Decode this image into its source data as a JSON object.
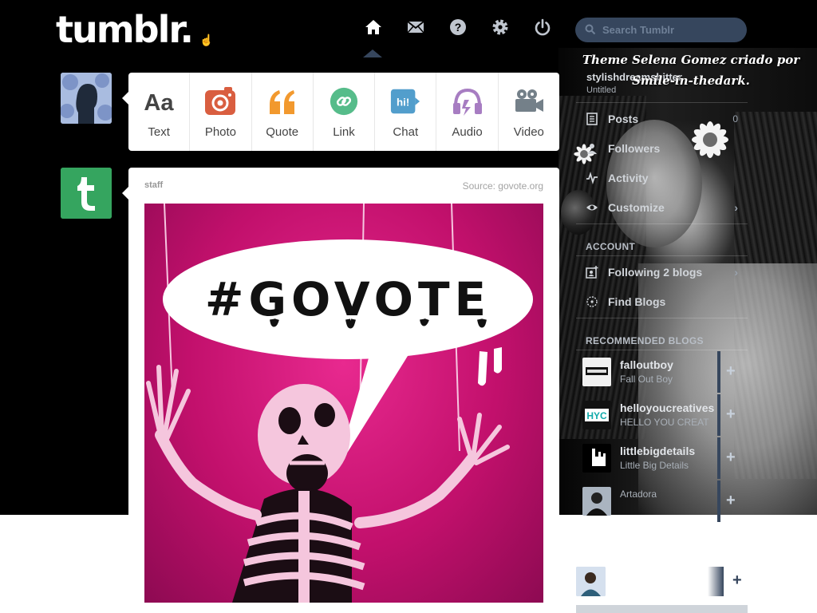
{
  "header": {
    "logo": "tumblr.",
    "search_placeholder": "Search Tumblr",
    "nav": [
      "home-icon",
      "inbox-icon",
      "help-icon",
      "settings-icon",
      "logout-icon"
    ],
    "accent_color": "#36465d"
  },
  "theme_credit": {
    "line1": "Theme Selena Gomez criado por",
    "line2": "Smile-in-thedark."
  },
  "post_types": [
    {
      "label": "Text",
      "icon": "text-icon",
      "color": "#444444"
    },
    {
      "label": "Photo",
      "icon": "photo-icon",
      "color": "#d95e40"
    },
    {
      "label": "Quote",
      "icon": "quote-icon",
      "color": "#f2992e"
    },
    {
      "label": "Link",
      "icon": "link-icon",
      "color": "#56bc8a"
    },
    {
      "label": "Chat",
      "icon": "chat-icon",
      "color": "#529ecc"
    },
    {
      "label": "Audio",
      "icon": "audio-icon",
      "color": "#a77dc2"
    },
    {
      "label": "Video",
      "icon": "video-icon",
      "color": "#748089"
    }
  ],
  "post": {
    "author": "staff",
    "source": "Source: govote.org",
    "image_text": "#GOVOTE",
    "image_bg": "#c2106c"
  },
  "sidebar": {
    "blog_name": "stylishdreamsbitter",
    "blog_sub": "Untitled",
    "posts_label": "Posts",
    "posts_count": "0",
    "followers_label": "Followers",
    "activity_label": "Activity",
    "customize_label": "Customize",
    "account_heading": "ACCOUNT",
    "following_label": "Following 2 blogs",
    "find_blogs_label": "Find Blogs",
    "recommended_heading": "RECOMMENDED BLOGS",
    "recommended": [
      {
        "name": "falloutboy",
        "title": "Fall Out Boy"
      },
      {
        "name": "helloyoucreatives",
        "title": "HELLO YOU CREAT"
      },
      {
        "name": "littlebigdetails",
        "title": "Little Big Details"
      },
      {
        "name": "",
        "title": "Artadora"
      }
    ]
  }
}
